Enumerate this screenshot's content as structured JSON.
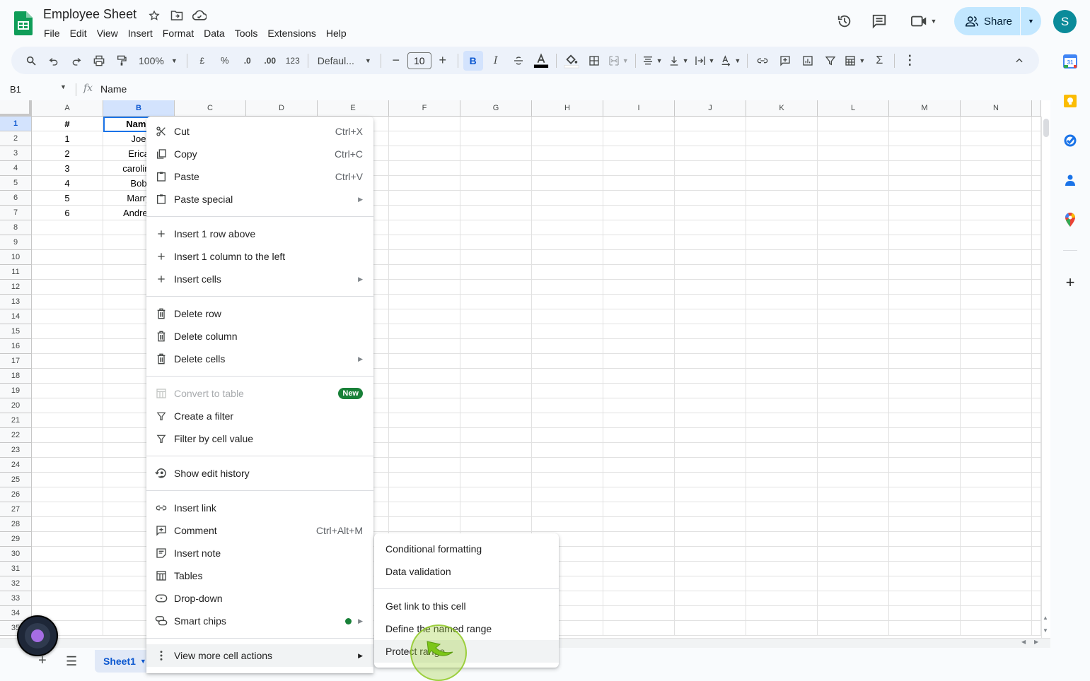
{
  "app": {
    "title": "Employee Sheet",
    "brand_color": "#0f9d58",
    "accent_color": "#0b57d0"
  },
  "menubar": [
    "File",
    "Edit",
    "View",
    "Insert",
    "Format",
    "Data",
    "Tools",
    "Extensions",
    "Help"
  ],
  "header": {
    "share_label": "Share",
    "avatar_initial": "S"
  },
  "toolbar": {
    "zoom": "100%",
    "currency": "£",
    "percent": "%",
    "dec_decrease": ".0",
    "dec_increase": ".00",
    "number_format": "123",
    "font": "Defaul...",
    "font_size": "10",
    "bold": "B",
    "italic": "I",
    "sum": "Σ"
  },
  "formula_bar": {
    "cell_ref": "B1",
    "fx": "fx",
    "value": "Name"
  },
  "grid": {
    "columns": [
      "A",
      "B",
      "C",
      "D",
      "E",
      "F",
      "G",
      "H",
      "I",
      "J",
      "K",
      "L",
      "M",
      "N"
    ],
    "selected_column": "B",
    "selected_row": 1,
    "row_numbers": [
      "1",
      "2",
      "3",
      "4",
      "5",
      "6",
      "7",
      "8",
      "9",
      "10",
      "11",
      "12",
      "13",
      "14",
      "15",
      "16",
      "17",
      "18",
      "19",
      "20",
      "21",
      "22",
      "23",
      "24",
      "25",
      "26",
      "27",
      "28",
      "29",
      "30",
      "31",
      "32",
      "33",
      "34",
      "35"
    ],
    "rows": [
      {
        "a": "#",
        "b": "Name"
      },
      {
        "a": "1",
        "b": "Joe"
      },
      {
        "a": "2",
        "b": "Erica"
      },
      {
        "a": "3",
        "b": "caroline"
      },
      {
        "a": "4",
        "b": "Bob"
      },
      {
        "a": "5",
        "b": "Marry"
      },
      {
        "a": "6",
        "b": "Andrew"
      }
    ]
  },
  "context_menu": {
    "groups": [
      [
        {
          "icon": "scissors-icon",
          "label": "Cut",
          "shortcut": "Ctrl+X"
        },
        {
          "icon": "copy-icon",
          "label": "Copy",
          "shortcut": "Ctrl+C"
        },
        {
          "icon": "clipboard-icon",
          "label": "Paste",
          "shortcut": "Ctrl+V"
        },
        {
          "icon": "clipboard-icon",
          "label": "Paste special",
          "submenu": true
        }
      ],
      [
        {
          "icon": "plus-icon",
          "label": "Insert 1 row above"
        },
        {
          "icon": "plus-icon",
          "label": "Insert 1 column to the left"
        },
        {
          "icon": "plus-icon",
          "label": "Insert cells",
          "submenu": true
        }
      ],
      [
        {
          "icon": "trash-icon",
          "label": "Delete row"
        },
        {
          "icon": "trash-icon",
          "label": "Delete column"
        },
        {
          "icon": "trash-icon",
          "label": "Delete cells",
          "submenu": true
        }
      ],
      [
        {
          "icon": "table-icon",
          "label": "Convert to table",
          "badge": "New",
          "disabled": true
        },
        {
          "icon": "filter-icon",
          "label": "Create a filter"
        },
        {
          "icon": "filter-icon",
          "label": "Filter by cell value"
        }
      ],
      [
        {
          "icon": "history-icon",
          "label": "Show edit history"
        }
      ],
      [
        {
          "icon": "link-icon",
          "label": "Insert link"
        },
        {
          "icon": "comment-icon",
          "label": "Comment",
          "shortcut": "Ctrl+Alt+M"
        },
        {
          "icon": "note-icon",
          "label": "Insert note"
        },
        {
          "icon": "table-icon",
          "label": "Tables"
        },
        {
          "icon": "dropdown-icon",
          "label": "Drop-down"
        },
        {
          "icon": "smart-chips-icon",
          "label": "Smart chips",
          "submenu": true,
          "dot": true
        }
      ],
      [
        {
          "icon": "more-vert-icon",
          "label": "View more cell actions",
          "submenu": true,
          "hover": true
        }
      ]
    ]
  },
  "sub_menu": {
    "groups": [
      [
        "Conditional formatting",
        "Data validation"
      ],
      [
        "Get link to this cell",
        "Define the named range",
        "Protect range"
      ]
    ],
    "hovered": "Protect range"
  },
  "sheets": {
    "tabs": [
      "Sheet1"
    ],
    "active": "Sheet1"
  }
}
